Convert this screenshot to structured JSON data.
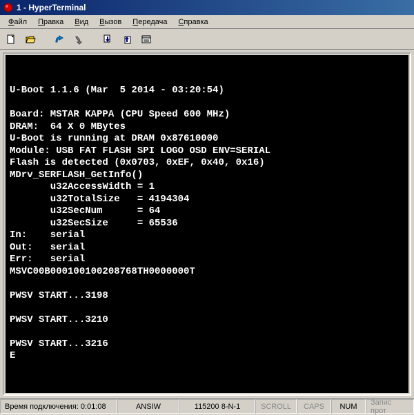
{
  "title": "1 - HyperTerminal",
  "menu": {
    "file": "Файл",
    "edit": "Правка",
    "view": "Вид",
    "call": "Вызов",
    "transfer": "Передача",
    "help": "Справка"
  },
  "terminal": {
    "lines": [
      "",
      "",
      "U-Boot 1.1.6 (Mar  5 2014 - 03:20:54)",
      "",
      "Board: MSTAR KAPPA (CPU Speed 600 MHz)",
      "DRAM:  64 X 0 MBytes",
      "U-Boot is running at DRAM 0x87610000",
      "Module: USB FAT FLASH SPI LOGO OSD ENV=SERIAL",
      "Flash is detected (0x0703, 0xEF, 0x40, 0x16)",
      "MDrv_SERFLASH_GetInfo()",
      "       u32AccessWidth = 1",
      "       u32TotalSize   = 4194304",
      "       u32SecNum      = 64",
      "       u32SecSize     = 65536",
      "In:    serial",
      "Out:   serial",
      "Err:   serial",
      "MSVC00B000100100208768TH0000000T",
      "",
      "PWSV START...3198",
      "",
      "PWSV START...3210",
      "",
      "PWSV START...3216",
      "E"
    ]
  },
  "status": {
    "conn_label": "Время подключения: 0:01:08",
    "mode": "ANSIW",
    "baud": "115200 8-N-1",
    "scroll": "SCROLL",
    "caps": "CAPS",
    "num": "NUM",
    "rest": "Запис прот"
  }
}
